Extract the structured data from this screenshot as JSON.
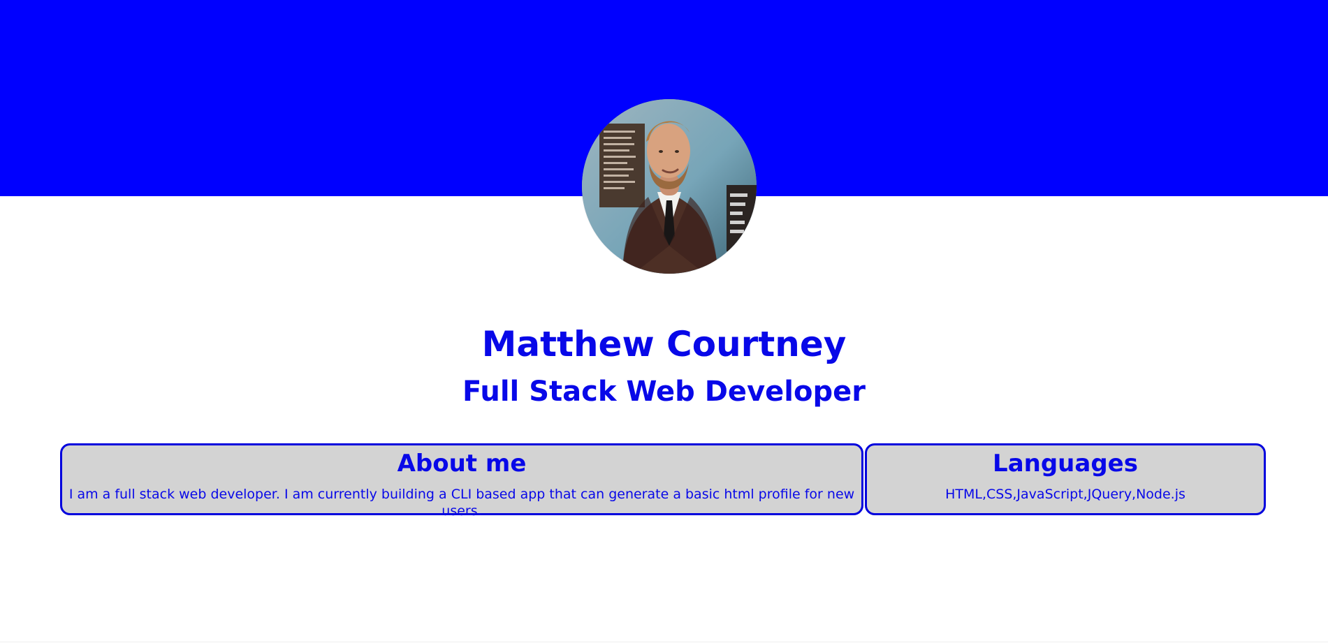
{
  "profile": {
    "name": "Matthew Courtney",
    "role": "Full Stack Web Developer",
    "avatar_icon": "profile-photo"
  },
  "about": {
    "heading": "About me",
    "text": "I am a full stack web developer. I am currently building a CLI based app that can generate a basic html profile for new users."
  },
  "languages": {
    "heading": "Languages",
    "text": "HTML,CSS,JavaScript,JQuery,Node.js"
  },
  "colors": {
    "banner": "#0000ff",
    "text": "#0808e8",
    "card_background": "#d3d3d3",
    "card_border": "#0000dd",
    "page_background": "#ffffff"
  }
}
